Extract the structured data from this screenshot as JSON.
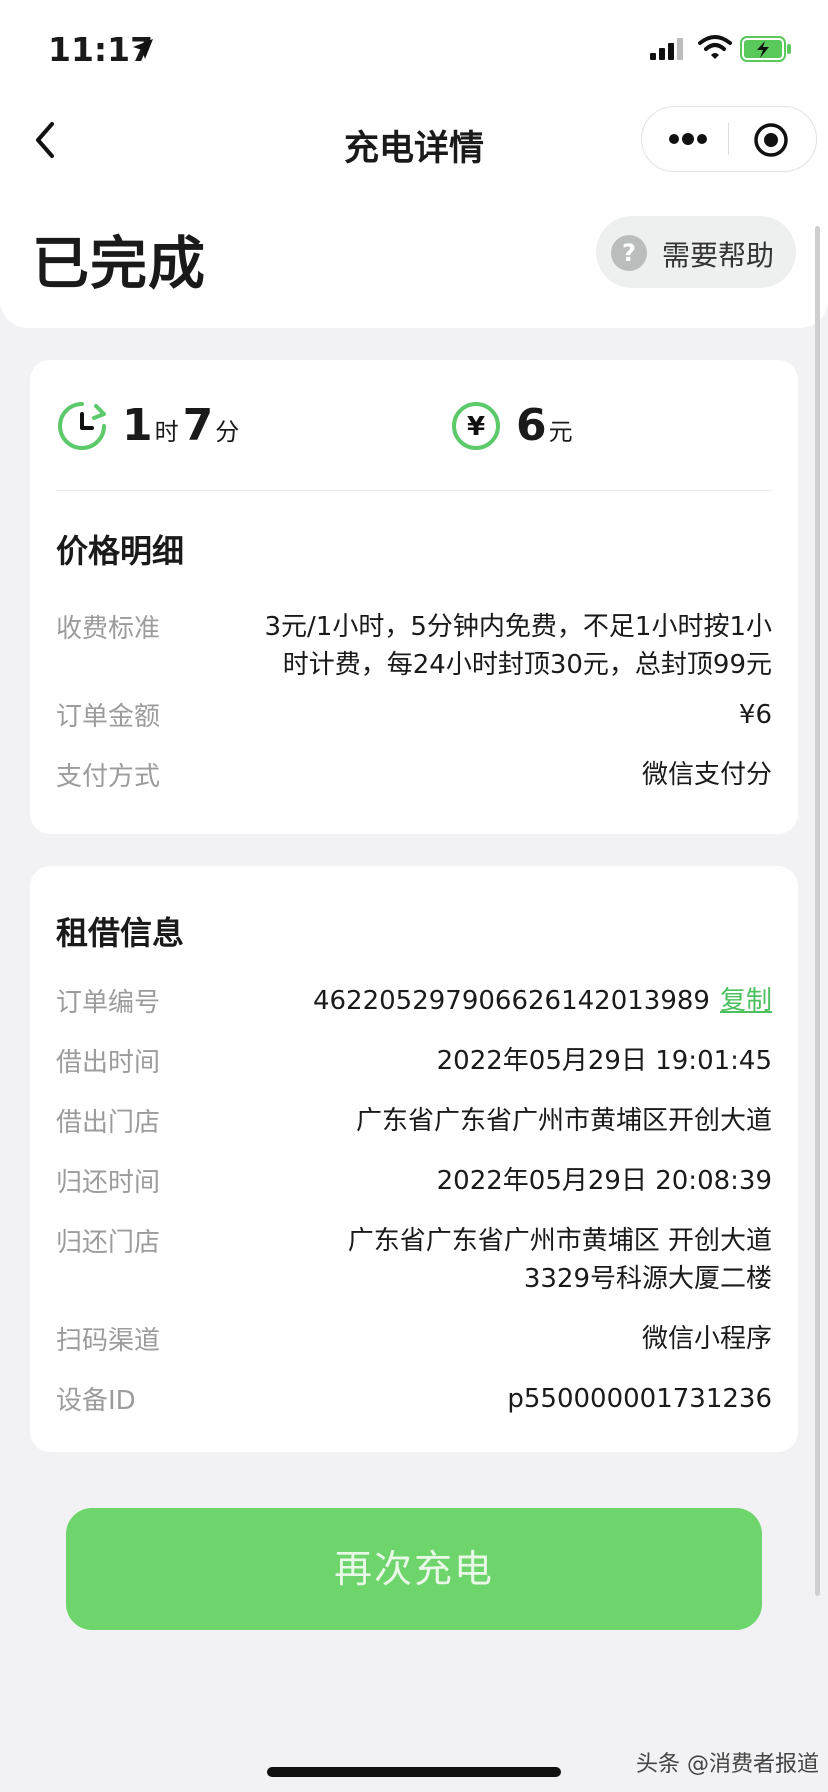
{
  "status_bar": {
    "time": "11:17",
    "icons": [
      "location-arrow-icon",
      "cellular-signal-icon",
      "wifi-icon",
      "battery-charging-icon"
    ]
  },
  "nav": {
    "title": "充电详情",
    "back_icon": "chevron-left-icon",
    "more_icon": "more-dots-icon",
    "close_icon": "target-circle-icon"
  },
  "order_status": "已完成",
  "help": {
    "label": "需要帮助",
    "icon": "question-icon"
  },
  "summary": {
    "duration": {
      "hours": "1",
      "hour_unit": "时",
      "minutes": "7",
      "minute_unit": "分"
    },
    "amount": {
      "value": "6",
      "unit": "元"
    },
    "icons": [
      "clock-icon",
      "yen-icon"
    ]
  },
  "price_details": {
    "title": "价格明细",
    "rows": [
      {
        "label": "收费标准",
        "value_line1": "3元/1小时，5分钟内免费，不足1小时按1小",
        "value_line2": "时计费，每24小时封顶30元，总封顶99元"
      },
      {
        "label": "订单金额",
        "value": "¥6"
      },
      {
        "label": "支付方式",
        "value": "微信支付分"
      }
    ]
  },
  "rental_info": {
    "title": "租借信息",
    "rows": [
      {
        "label": "订单编号",
        "value": "46220529790662614​2013989",
        "action": "复制"
      },
      {
        "label": "借出时间",
        "value": "2022年05月29日 19:01:45"
      },
      {
        "label": "借出门店",
        "value": "广东省广东省广州市黄埔区开创大道"
      },
      {
        "label": "归还时间",
        "value": "2022年05月29日 20:08:39"
      },
      {
        "label": "归还门店",
        "value_line1": "广东省广东省广州市黄埔区 开创大道",
        "value_line2": "3329号科源大厦二楼"
      },
      {
        "label": "扫码渠道",
        "value": "微信小程序"
      },
      {
        "label": "设备ID",
        "value": "p550000001731236"
      }
    ]
  },
  "recharge_button": "再次充电",
  "watermark": "头条 @消费者报道",
  "colors": {
    "accent_green": "#6dd56b",
    "link_green": "#4cbf5e",
    "label_gray": "#9c9c9c",
    "background": "#f2f2f4"
  }
}
